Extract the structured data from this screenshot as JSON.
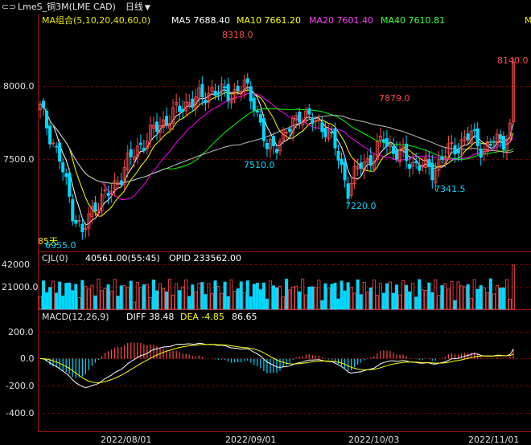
{
  "topbar": {
    "symbol": "LmeS_铜3M(LME CAD)",
    "period": "日线"
  },
  "main_legend": {
    "ma_title": "MA组合(5,10,20,40,60,0)",
    "ma5": "MA5 7688.40",
    "ma10": "MA10 7661.20",
    "ma20": "MA20 7601.40",
    "ma40": "MA40 7610.81",
    "ma60_cut": "M",
    "days_note": "85天"
  },
  "volume_legend": {
    "title": "CJL(0)",
    "vol": "40561.00(55:45)",
    "opid": "OPID 233562.00"
  },
  "macd_legend": {
    "title": "MACD(12,26,9)",
    "diff": "DIFF 38.48",
    "dea": "DEA -4.85",
    "macd": "86.65"
  },
  "axes": {
    "price_ticks": [
      "8000.0",
      "7500.0"
    ],
    "volume_ticks": [
      "42000",
      "21000.0"
    ],
    "macd_ticks": [
      "200.0",
      "0.0",
      "-200.0",
      "-400.0"
    ],
    "date_ticks": [
      "2022/08/01",
      "2022/09/01",
      "2022/10/03",
      "2022/11/01"
    ]
  },
  "annotations": {
    "high1": "8318.0",
    "high2": "7879.0",
    "last": "8140.0",
    "low1": "6955.0",
    "low2": "7510.0",
    "low3": "7220.0",
    "low4": "7341.5"
  },
  "colors": {
    "up": "#ff4b4b",
    "down": "#00d8ff",
    "grid": "#8b0000",
    "axis": "#a01010",
    "ma5": "#ffffff",
    "ma10": "#ffff00",
    "ma20": "#ff00ff",
    "ma40": "#00ff00",
    "ma60": "#c0c0c0"
  },
  "chart_data": {
    "type": "candlestick",
    "price_axis_ticks": [
      8000,
      7500
    ],
    "annotated_high": 8318.0,
    "annotated_low": 6955.0,
    "last_close": 8140.0,
    "ma": {
      "MA5": 7688.4,
      "MA10": 7661.2,
      "MA20": 7601.4,
      "MA40": 7610.81
    },
    "volume": {
      "last": 40561.0,
      "open_interest": 233562.0
    },
    "macd": {
      "DIFF": 38.48,
      "DEA": -4.85,
      "MACD": 86.65
    }
  }
}
